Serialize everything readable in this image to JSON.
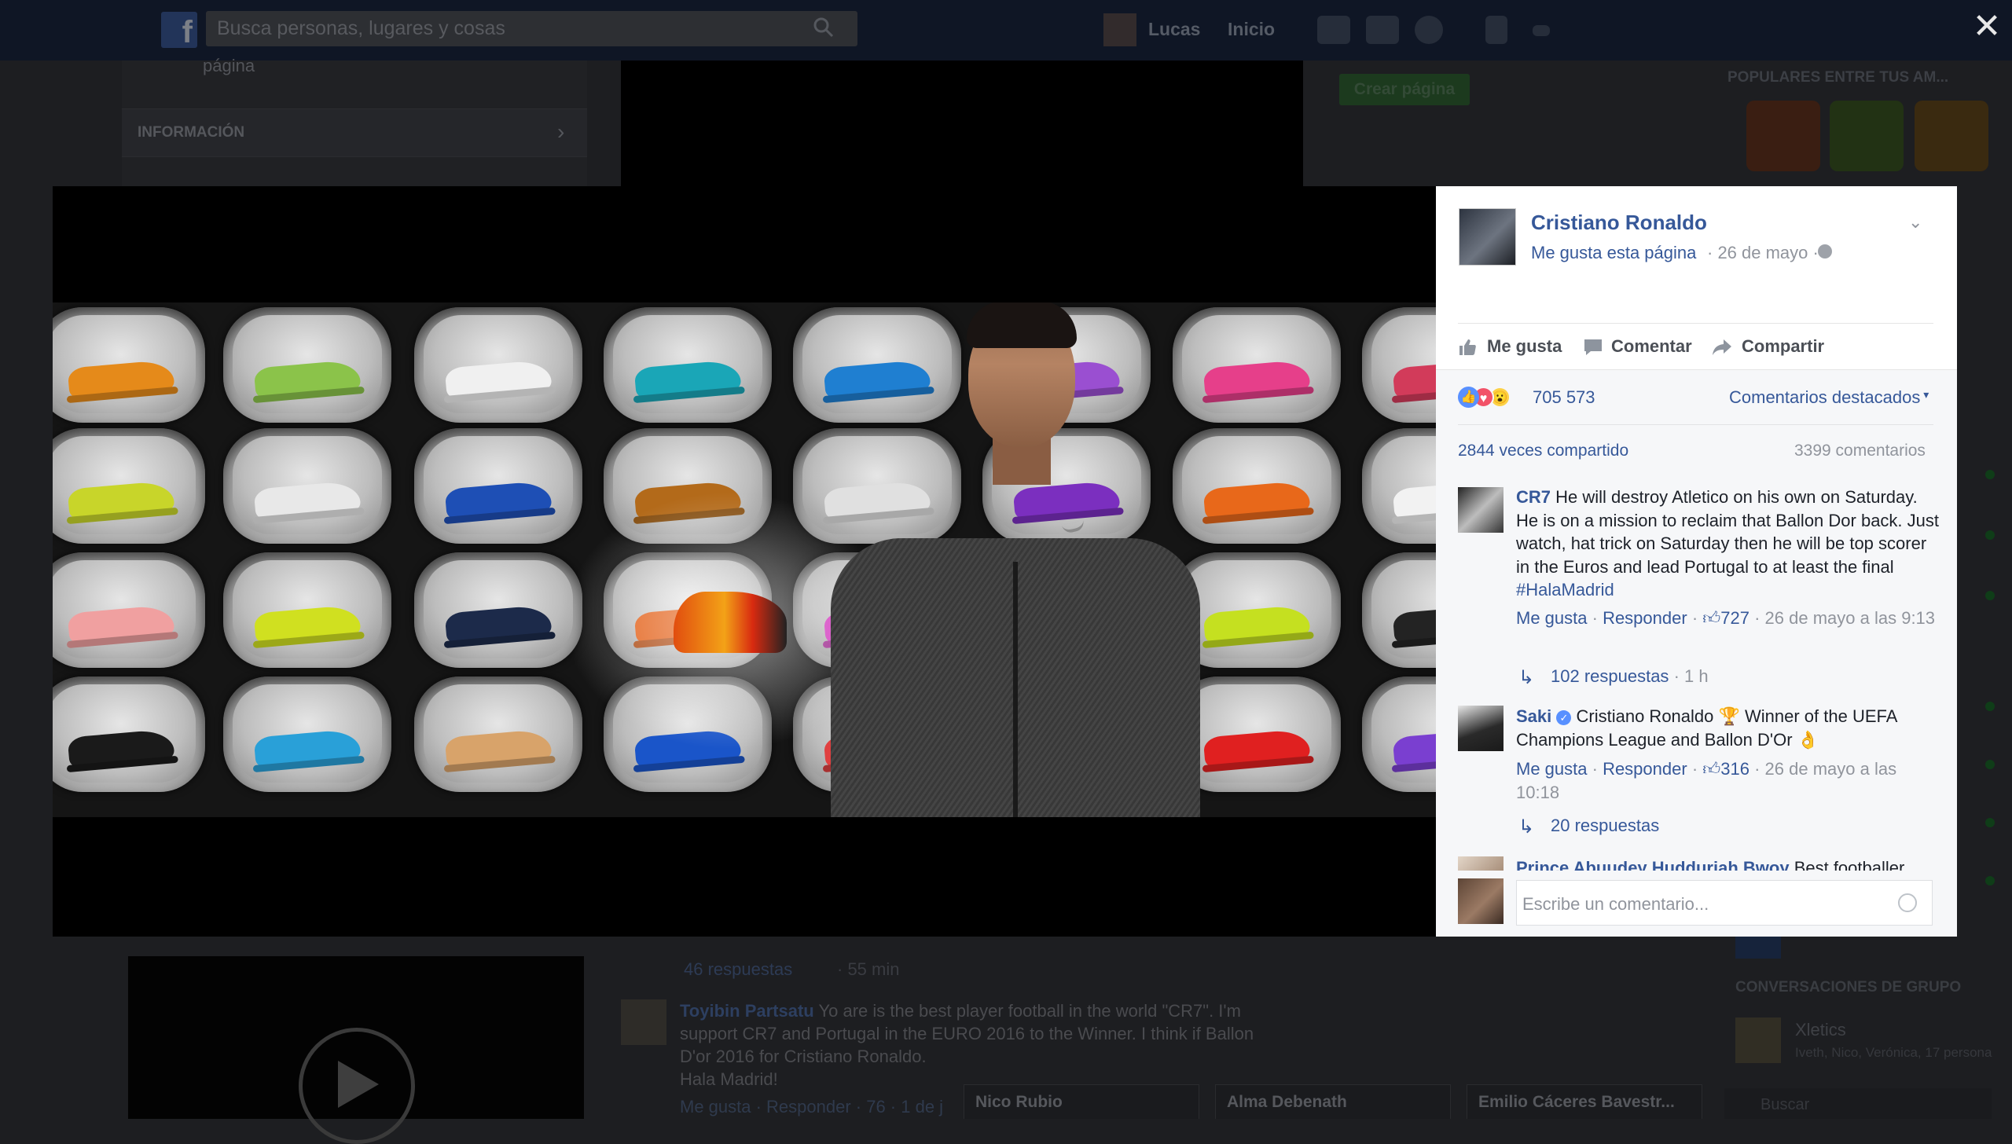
{
  "topbar": {
    "search_placeholder": "Busca personas, lugares y cosas",
    "user_name": "Lucas",
    "home_label": "Inicio"
  },
  "background": {
    "page_label": "página",
    "info_label": "INFORMACIÓN",
    "create_page_label": "Crear página",
    "popular_label": "POPULARES ENTRE TUS AM...",
    "bg_replies": "46 respuestas",
    "bg_replies_time": "· 55 min",
    "bg_comment_name": "Toyibin Partsatu",
    "bg_comment_text": "Yo are is the best player football in the world \"CR7\". I'm support CR7 and Portugal in the EURO 2016 to the Winner. I think if Ballon D'or 2016 for Cristiano Ronaldo.",
    "bg_comment_text2": "Hala Madrid!",
    "bg_comment_meta": "Me gusta · Responder · 76 · 1 de j",
    "group_chats_label": "CONVERSACIONES DE GRUPO",
    "group_name": "Xletics",
    "group_members": "Iveth, Nico, Verónica, 17 persona",
    "chat_search_placeholder": "Buscar",
    "chat_tabs": [
      "Nico Rubio",
      "Alma Debenath",
      "Emilio Cáceres Bavestr..."
    ]
  },
  "post": {
    "page_name": "Cristiano Ronaldo",
    "like_page": "Me gusta esta página",
    "date": "· 26 de mayo ·",
    "actions": {
      "like": "Me gusta",
      "comment": "Comentar",
      "share": "Compartir"
    },
    "reactions_count": "705 573",
    "sort_label": "Comentarios destacados",
    "shares": "2844 veces compartido",
    "comments_count": "3399 comentarios"
  },
  "comments": [
    {
      "name": "CR7",
      "text": "He will destroy Atletico on his own on Saturday. He is on a mission to reclaim that Ballon Dor back. Just watch, hat trick on Saturday then he will be top scorer in the Euros and lead Portugal to at least the final ",
      "hashtag": "#HalaMadrid",
      "like": "Me gusta",
      "reply": "Responder",
      "likes": "727",
      "time": "· 26 de mayo a las 9:13",
      "replies": "102 respuestas",
      "replies_time": "· 1 h"
    },
    {
      "name": "Saki",
      "text": "Cristiano Ronaldo 🏆 Winner of the UEFA Champions League and Ballon D'Or 👌",
      "like": "Me gusta",
      "reply": "Responder",
      "likes": "316",
      "time": "· 26 de mayo a las 10:18",
      "replies": "20 respuestas"
    },
    {
      "name": "Prince Abuudey Hudduriah Bwoy",
      "text": "Best footballer"
    }
  ],
  "composer": {
    "placeholder": "Escribe un comentario..."
  },
  "colors": {
    "link": "#365899",
    "like_blue": "#5890ff",
    "love_red": "#f25268",
    "wow_yellow": "#fcd146"
  },
  "icons": {
    "like": "thumbs-up-icon",
    "comment": "speech-bubble-icon",
    "share": "share-arrow-icon",
    "close": "close-icon",
    "globe": "globe-icon"
  }
}
